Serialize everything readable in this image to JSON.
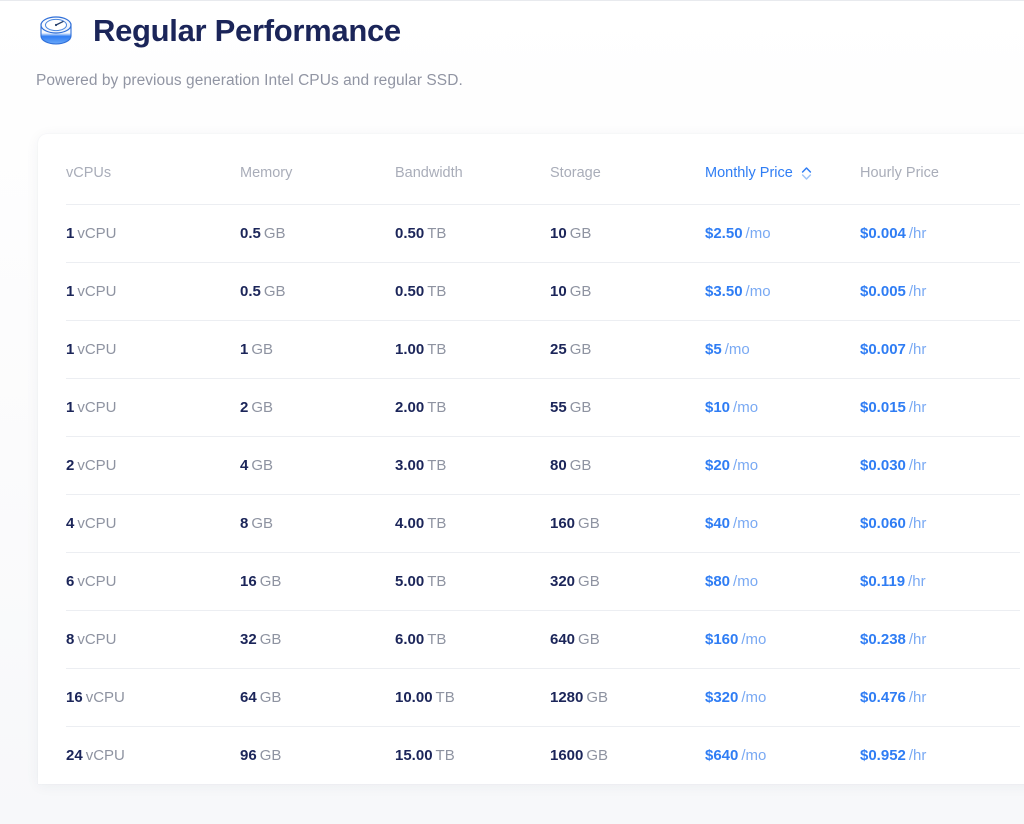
{
  "header": {
    "icon": "disk-performance-icon",
    "title": "Regular Performance",
    "subtitle": "Powered by previous generation Intel CPUs and regular SSD."
  },
  "colors": {
    "accent": "#2f7df4",
    "accent_muted": "#79a9f3",
    "title": "#1b2559",
    "muted": "#9195a3",
    "header_muted": "#a9adb9",
    "row_border": "#eceef2",
    "card_bg": "#ffffff",
    "page_bg": "#fbfbfc"
  },
  "table": {
    "sort": {
      "column": "Monthly Price",
      "icon": "sort-chevrons-icon"
    },
    "columns": [
      {
        "key": "vcpus",
        "label": "vCPUs",
        "sorted": false,
        "sortable": true
      },
      {
        "key": "memory",
        "label": "Memory",
        "sorted": false,
        "sortable": true
      },
      {
        "key": "bandwidth",
        "label": "Bandwidth",
        "sorted": false,
        "sortable": true
      },
      {
        "key": "storage",
        "label": "Storage",
        "sorted": false,
        "sortable": true
      },
      {
        "key": "monthly",
        "label": "Monthly Price",
        "sorted": true,
        "sortable": true
      },
      {
        "key": "hourly",
        "label": "Hourly Price",
        "sorted": false,
        "sortable": true
      }
    ],
    "rows": [
      {
        "vcpus": [
          "1",
          "vCPU"
        ],
        "memory": [
          "0.5",
          "GB"
        ],
        "bandwidth": [
          "0.50",
          "TB"
        ],
        "storage": [
          "10",
          "GB"
        ],
        "monthly": [
          "$2.50",
          "/mo"
        ],
        "hourly": [
          "$0.004",
          "/hr"
        ]
      },
      {
        "vcpus": [
          "1",
          "vCPU"
        ],
        "memory": [
          "0.5",
          "GB"
        ],
        "bandwidth": [
          "0.50",
          "TB"
        ],
        "storage": [
          "10",
          "GB"
        ],
        "monthly": [
          "$3.50",
          "/mo"
        ],
        "hourly": [
          "$0.005",
          "/hr"
        ]
      },
      {
        "vcpus": [
          "1",
          "vCPU"
        ],
        "memory": [
          "1",
          "GB"
        ],
        "bandwidth": [
          "1.00",
          "TB"
        ],
        "storage": [
          "25",
          "GB"
        ],
        "monthly": [
          "$5",
          "/mo"
        ],
        "hourly": [
          "$0.007",
          "/hr"
        ]
      },
      {
        "vcpus": [
          "1",
          "vCPU"
        ],
        "memory": [
          "2",
          "GB"
        ],
        "bandwidth": [
          "2.00",
          "TB"
        ],
        "storage": [
          "55",
          "GB"
        ],
        "monthly": [
          "$10",
          "/mo"
        ],
        "hourly": [
          "$0.015",
          "/hr"
        ]
      },
      {
        "vcpus": [
          "2",
          "vCPU"
        ],
        "memory": [
          "4",
          "GB"
        ],
        "bandwidth": [
          "3.00",
          "TB"
        ],
        "storage": [
          "80",
          "GB"
        ],
        "monthly": [
          "$20",
          "/mo"
        ],
        "hourly": [
          "$0.030",
          "/hr"
        ]
      },
      {
        "vcpus": [
          "4",
          "vCPU"
        ],
        "memory": [
          "8",
          "GB"
        ],
        "bandwidth": [
          "4.00",
          "TB"
        ],
        "storage": [
          "160",
          "GB"
        ],
        "monthly": [
          "$40",
          "/mo"
        ],
        "hourly": [
          "$0.060",
          "/hr"
        ]
      },
      {
        "vcpus": [
          "6",
          "vCPU"
        ],
        "memory": [
          "16",
          "GB"
        ],
        "bandwidth": [
          "5.00",
          "TB"
        ],
        "storage": [
          "320",
          "GB"
        ],
        "monthly": [
          "$80",
          "/mo"
        ],
        "hourly": [
          "$0.119",
          "/hr"
        ]
      },
      {
        "vcpus": [
          "8",
          "vCPU"
        ],
        "memory": [
          "32",
          "GB"
        ],
        "bandwidth": [
          "6.00",
          "TB"
        ],
        "storage": [
          "640",
          "GB"
        ],
        "monthly": [
          "$160",
          "/mo"
        ],
        "hourly": [
          "$0.238",
          "/hr"
        ]
      },
      {
        "vcpus": [
          "16",
          "vCPU"
        ],
        "memory": [
          "64",
          "GB"
        ],
        "bandwidth": [
          "10.00",
          "TB"
        ],
        "storage": [
          "1280",
          "GB"
        ],
        "monthly": [
          "$320",
          "/mo"
        ],
        "hourly": [
          "$0.476",
          "/hr"
        ]
      },
      {
        "vcpus": [
          "24",
          "vCPU"
        ],
        "memory": [
          "96",
          "GB"
        ],
        "bandwidth": [
          "15.00",
          "TB"
        ],
        "storage": [
          "1600",
          "GB"
        ],
        "monthly": [
          "$640",
          "/mo"
        ],
        "hourly": [
          "$0.952",
          "/hr"
        ]
      }
    ]
  }
}
